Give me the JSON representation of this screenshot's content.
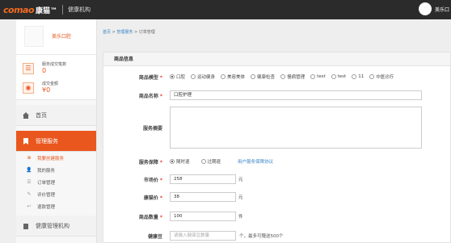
{
  "header": {
    "logo_mark": "comao",
    "logo_cn": "康猫™",
    "subtitle": "健康机构",
    "username": "美乐口"
  },
  "sidebar": {
    "profile_name": "美乐口腔",
    "stats": [
      {
        "label": "服务成交笔数",
        "value": "0",
        "icon": "list-icon"
      },
      {
        "label": "成交金额",
        "value": "¥0",
        "icon": "money-icon"
      }
    ],
    "menu": [
      {
        "label": "首页",
        "icon": "home-icon"
      },
      {
        "label": "管理服务",
        "icon": "bookmark-icon",
        "active": true
      },
      {
        "label": "健康管理机构",
        "icon": "building-icon"
      }
    ],
    "subitems": [
      {
        "label": "我要创建服务",
        "icon": "plus-circle-icon",
        "highlight": true
      },
      {
        "label": "我的服务",
        "icon": "user-icon"
      },
      {
        "label": "订单管理",
        "icon": "list-icon"
      },
      {
        "label": "评价管理",
        "icon": "edit-icon"
      },
      {
        "label": "退款管理",
        "icon": "refund-icon"
      }
    ]
  },
  "breadcrumb": {
    "home": "首页",
    "sep1": " > ",
    "section": "管理服务",
    "sep2": " > ",
    "current": "订单管理"
  },
  "form": {
    "title": "商品信息",
    "model_label": "商品模型",
    "model_options": [
      "口腔",
      "运动健身",
      "美容美体",
      "健康检查",
      "慢病管理",
      "test",
      "test",
      "11",
      "中医诊疗"
    ],
    "model_selected": 0,
    "name_label": "商品名称",
    "name_value": "口腔护理",
    "summary_label": "服务摘要",
    "guarantee_label": "服务保障",
    "guarantee_options": [
      "随时退",
      "过期退"
    ],
    "guarantee_selected": 0,
    "guarantee_link": "用户服务保障协议",
    "market_label": "市场价",
    "market_value": "258",
    "market_unit": "元",
    "price_label": "康猫价",
    "price_value": "38",
    "price_unit": "元",
    "qty_label": "商品数量",
    "qty_value": "100",
    "qty_unit": "件",
    "bean_label": "健康豆",
    "bean_placeholder": "请输入健康豆数量",
    "bean_hint": "个，最多可赠送500个",
    "required_mark": "*"
  }
}
